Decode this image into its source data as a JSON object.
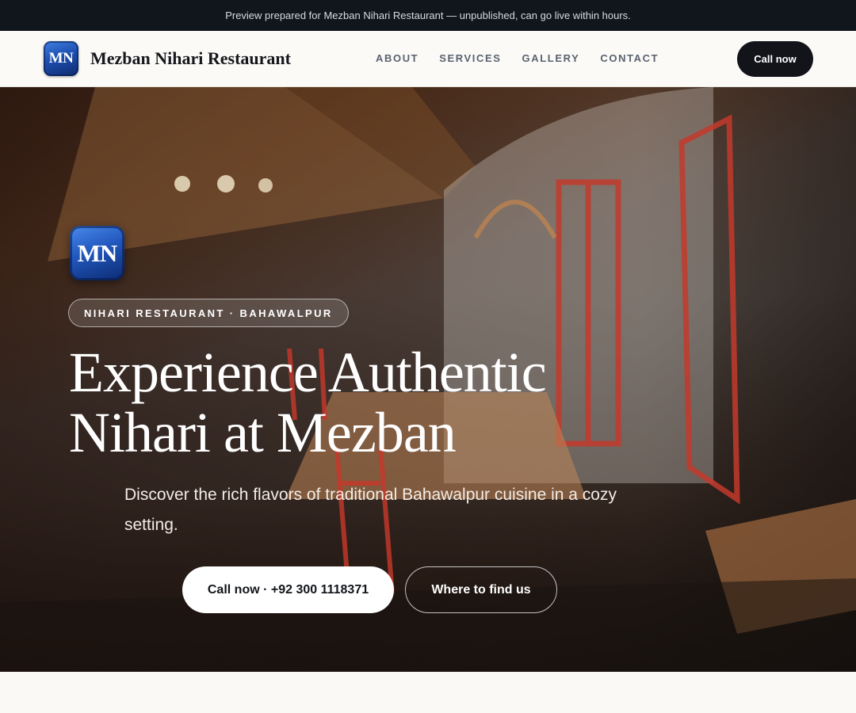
{
  "preview_bar": {
    "text": "Preview prepared for Mezban Nihari Restaurant — unpublished, can go live within hours."
  },
  "header": {
    "logo_text": "MN",
    "brand_name": "Mezban Nihari Restaurant",
    "nav": [
      "ABOUT",
      "SERVICES",
      "GALLERY",
      "CONTACT"
    ],
    "cta_label": "Call now"
  },
  "hero": {
    "logo_text": "MN",
    "pill": "NIHARI RESTAURANT · BAHAWALPUR",
    "title_line1": "Experience Authentic",
    "title_line2": "Nihari at Mezban",
    "subtitle": "Discover the rich flavors of traditional Bahawalpur cuisine in a cozy setting.",
    "primary_button": "Call now · +92 300 1118371",
    "secondary_button": "Where to find us",
    "background_image": "restaurant-interior-photo"
  },
  "colors": {
    "preview_bar_bg": "#11151c",
    "nav_bg": "#fbfaf7",
    "cta_bg": "#12141a",
    "logo_blue": "#2157bd",
    "page_bg": "#faf9f6"
  }
}
